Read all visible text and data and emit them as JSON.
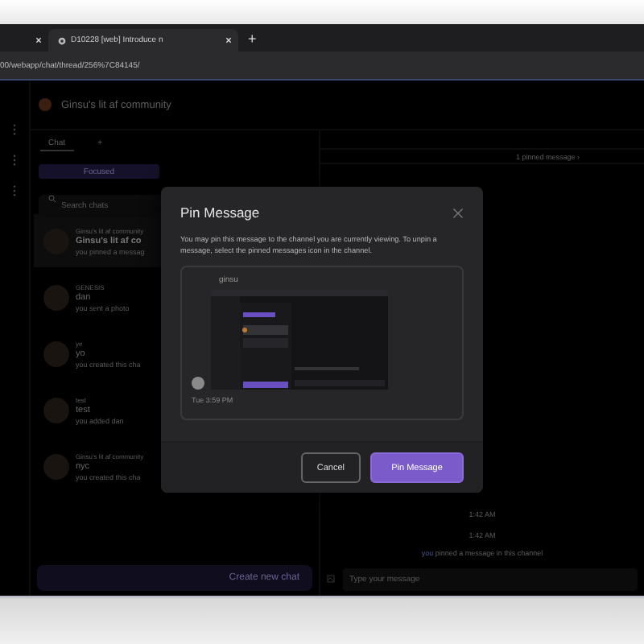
{
  "browser": {
    "tabs": [
      {
        "selected": false
      },
      {
        "title": "D10228 [web] Introduce n",
        "selected": true
      }
    ],
    "new_tab": "+",
    "address": "00/webapp/chat/thread/256%7C84145/"
  },
  "app": {
    "community": "Ginsu's lit af community",
    "tabs": [
      {
        "label": "Chat",
        "selected": true
      },
      {
        "label": "+",
        "selected": false
      }
    ],
    "filter": "Focused",
    "search_placeholder": "Search chats",
    "chats": [
      {
        "group": "Ginsu's lit af community",
        "name": "Ginsu's lit af co",
        "preview": "you pinned a messag",
        "selected": true
      },
      {
        "group": "GENESIS",
        "name": "dan",
        "preview": "you sent a photo",
        "selected": false
      },
      {
        "group": "ye",
        "name": "yo",
        "preview": "you created this cha",
        "selected": false
      },
      {
        "group": "test",
        "name": "test",
        "preview": "you added dan",
        "selected": false
      },
      {
        "group": "Ginsu's lit af community",
        "name": "nyc",
        "preview": "you created this cha",
        "selected": false
      }
    ],
    "create_button": "Create new chat",
    "pinned_banner": "1 pinned message ›",
    "timestamps": [
      "1:42 AM",
      "1:42 AM"
    ],
    "system_message": {
      "actor": "you",
      "text": "pinned a message in this channel"
    },
    "composer_placeholder": "Type your message"
  },
  "modal": {
    "title": "Pin Message",
    "description": "You may pin this message to the channel you are currently viewing. To unpin a message, select the pinned messages icon in the channel.",
    "message": {
      "author": "ginsu",
      "time": "Tue 3:59 PM",
      "kind": "picture"
    },
    "buttons": [
      {
        "label": "Cancel",
        "kind": "secondary"
      },
      {
        "label": "Pin Message",
        "kind": "primary"
      }
    ]
  }
}
